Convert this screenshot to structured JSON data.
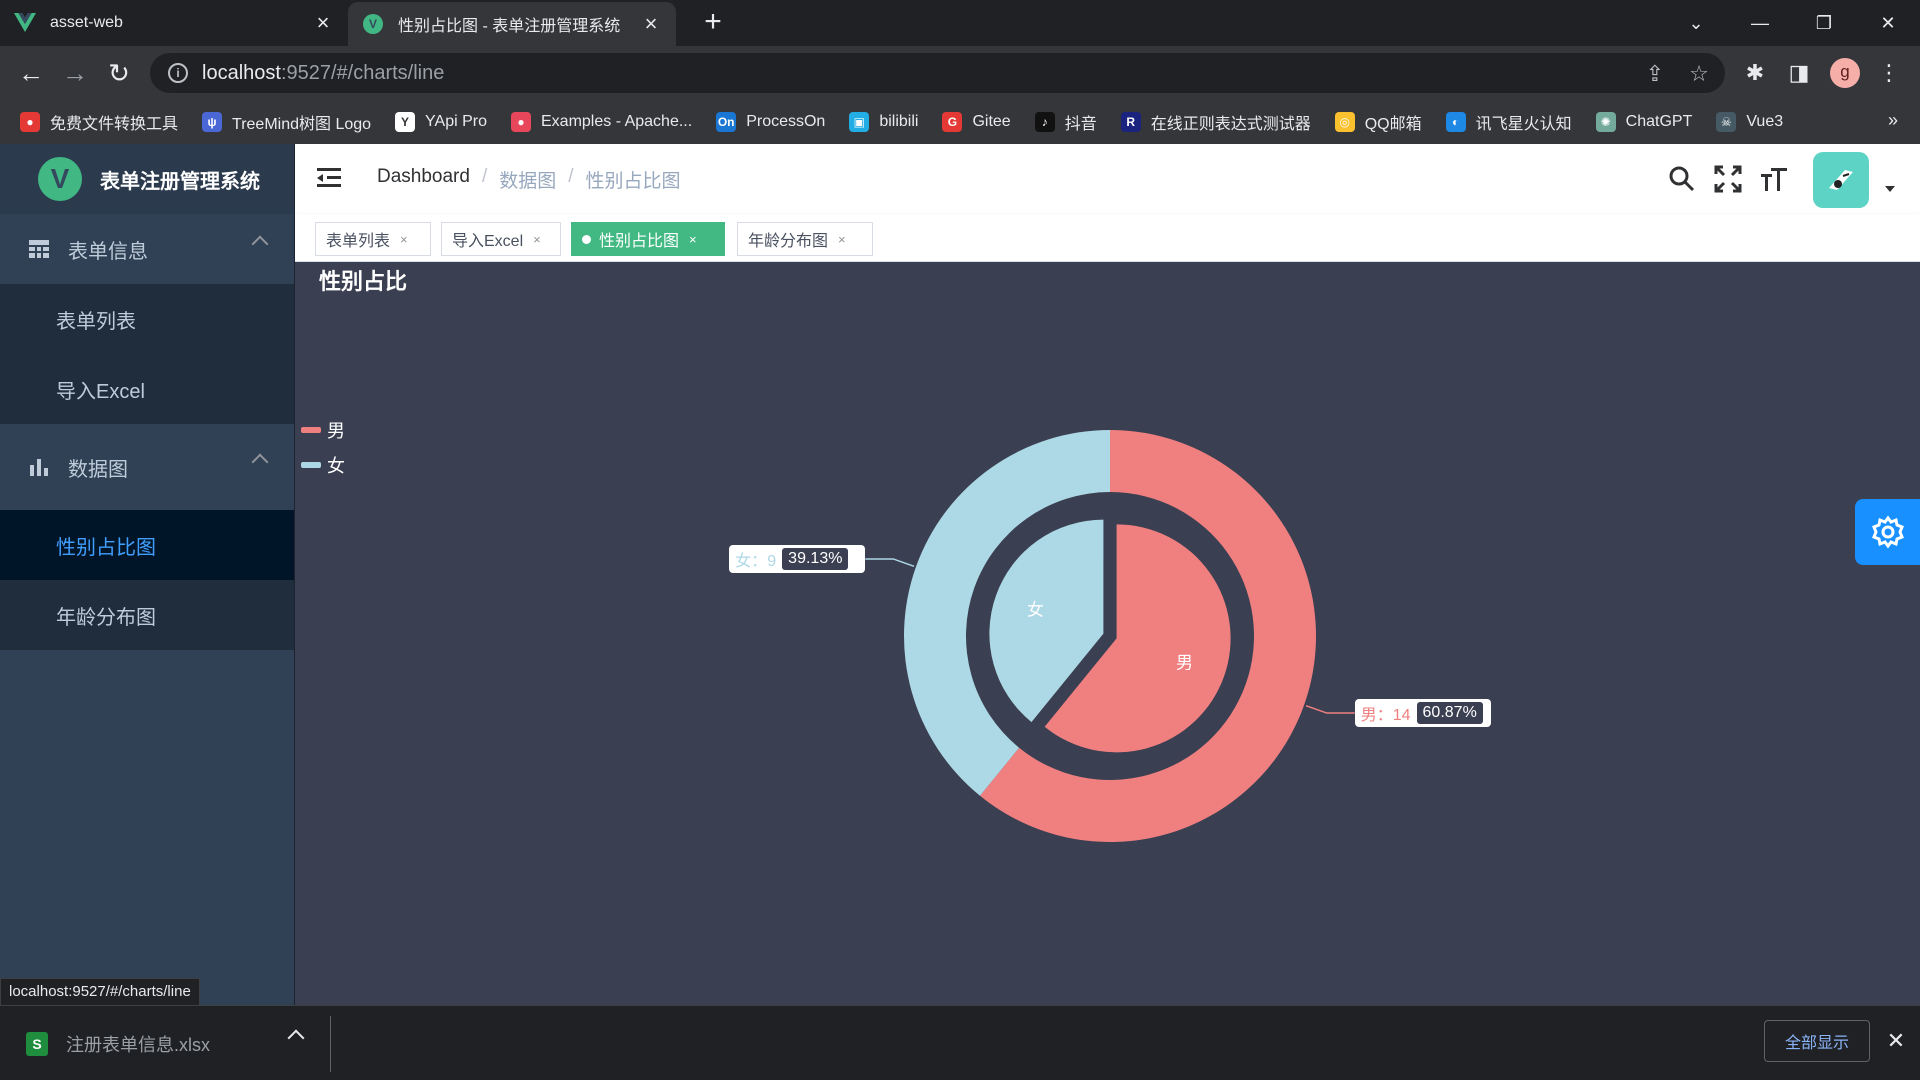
{
  "browser": {
    "tabs": [
      {
        "title": "asset-web",
        "active": false
      },
      {
        "title": "性别占比图 - 表单注册管理系统",
        "active": true
      }
    ],
    "address": {
      "host": "localhost",
      "rest": ":9527/#/charts/line"
    },
    "bookmarks": [
      {
        "label": "免费文件转换工具",
        "color": "#e53935",
        "glyph": "●"
      },
      {
        "label": "TreeMind树图 Logo",
        "color": "#4a67d6",
        "glyph": "ψ"
      },
      {
        "label": "YApi Pro",
        "color": "#ffffff",
        "glyph": "Y"
      },
      {
        "label": "Examples - Apache...",
        "color": "#e8475b",
        "glyph": "●"
      },
      {
        "label": "ProcessOn",
        "color": "#1976d2",
        "glyph": "On"
      },
      {
        "label": "bilibili",
        "color": "#23ade5",
        "glyph": "▣"
      },
      {
        "label": "Gitee",
        "color": "#e53935",
        "glyph": "G"
      },
      {
        "label": "抖音",
        "color": "#111111",
        "glyph": "♪"
      },
      {
        "label": "在线正则表达式测试器",
        "color": "#1a237e",
        "glyph": "R"
      },
      {
        "label": "QQ邮箱",
        "color": "#fbc02d",
        "glyph": "◎"
      },
      {
        "label": "讯飞星火认知",
        "color": "#1e88e5",
        "glyph": "◐"
      },
      {
        "label": "ChatGPT",
        "color": "#74aa9c",
        "glyph": "✺"
      },
      {
        "label": "Vue3",
        "color": "#455a64",
        "glyph": "☠"
      }
    ],
    "status_url": "localhost:9527/#/charts/line",
    "download": {
      "filename": "注册表单信息.xlsx",
      "icon_letter": "S",
      "show_all": "全部显示"
    },
    "profile_initial": "g"
  },
  "app": {
    "logo_letter": "V",
    "title": "表单注册管理系统",
    "menu": {
      "group1": {
        "label": "表单信息",
        "items": [
          "表单列表",
          "导入Excel"
        ]
      },
      "group2": {
        "label": "数据图",
        "items": [
          "性别占比图",
          "年龄分布图"
        ]
      }
    },
    "breadcrumb": [
      "Dashboard",
      "数据图",
      "性别占比图"
    ],
    "tags": [
      "表单列表",
      "导入Excel",
      "性别占比图",
      "年龄分布图"
    ],
    "page_title": "性别占比"
  },
  "colors": {
    "male": "#f08080",
    "female": "#add8e6",
    "accent": "#42b983",
    "link": "#409eff"
  },
  "chart_data": {
    "type": "pie",
    "title": "性别占比",
    "variant": "nested-donut",
    "legend_position": "left",
    "series": [
      {
        "name": "男",
        "value": 14,
        "percent": "60.87%",
        "color": "#f08080"
      },
      {
        "name": "女",
        "value": 9,
        "percent": "39.13%",
        "color": "#add8e6"
      }
    ]
  }
}
